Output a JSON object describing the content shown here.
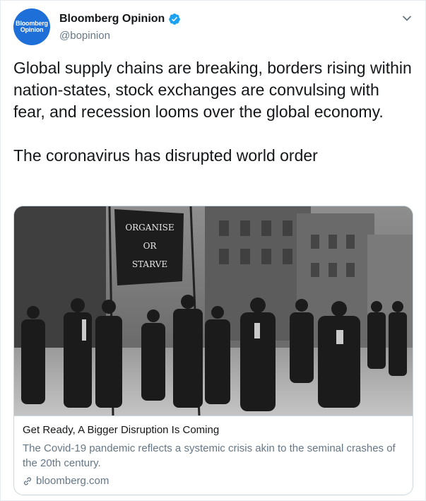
{
  "author": {
    "avatar_line1": "Bloomberg",
    "avatar_line2": "Opinion",
    "display_name": "Bloomberg Opinion",
    "handle": "@bopinion",
    "verified": true,
    "avatar_color": "#1f6fd8",
    "verified_color": "#1da1f2"
  },
  "menu": {
    "icon": "chevron-down-icon"
  },
  "tweet": {
    "paragraph1": "Global supply chains are breaking, borders rising within nation-states, stock exchanges are convulsing with fear, and recession looms over the global economy.",
    "paragraph2": "The coronavirus has disrupted world order"
  },
  "card": {
    "image_banner_text": [
      "ORGANISE",
      "OR",
      "STARVE"
    ],
    "title": "Get Ready, A Bigger Disruption Is Coming",
    "description": "The Covid-19 pandemic reflects a systemic crisis akin to the seminal crashes of the 20th century.",
    "domain": "bloomberg.com",
    "link_icon": "link-icon"
  }
}
